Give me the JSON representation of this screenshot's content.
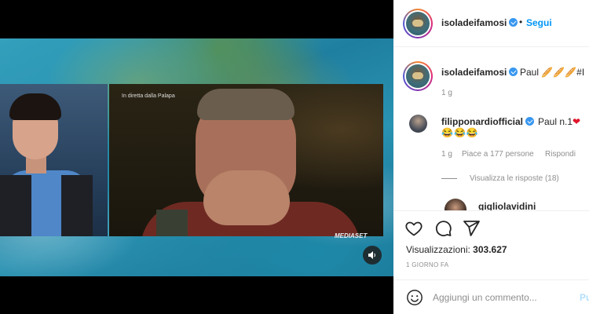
{
  "video": {
    "caption": "In diretta dalla Palapa",
    "broadcaster": "MEDIASET",
    "mute_icon": "speaker-icon"
  },
  "header": {
    "username": "isoladeifamosi",
    "separator": "•",
    "follow_label": "Segui"
  },
  "comments": [
    {
      "username": "isoladeifamosi",
      "text": "Paul 🥖🥖🥖#I",
      "time": "1 g"
    },
    {
      "username": "filipponardiofficial",
      "text_prefix": "Paul n.1",
      "heart": "❤",
      "emojis": "😂😂😂",
      "time": "1 g",
      "likes": "Piace a 177 persone",
      "reply_label": "Rispondi",
      "view_replies": "Visualizza le risposte (18)"
    },
    {
      "username": "gigliolavidini"
    }
  ],
  "actions": {
    "like_icon": "heart-icon",
    "comment_icon": "comment-icon",
    "share_icon": "share-icon",
    "views_label": "Visualizzazioni:",
    "views_count": "303.627",
    "date": "1 GIORNO FA"
  },
  "add_comment": {
    "placeholder": "Aggiungi un commento...",
    "publish_label": "Pu"
  }
}
